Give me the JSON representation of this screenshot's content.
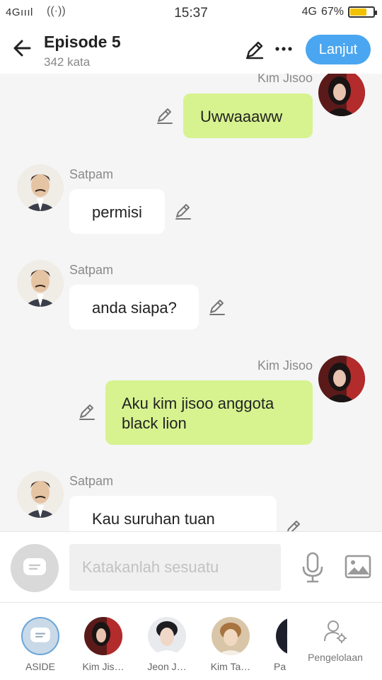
{
  "status": {
    "network": "4Gıııl",
    "time": "15:37",
    "network_right": "4G",
    "battery": "67%",
    "battery_level": 0.67
  },
  "header": {
    "title": "Episode 5",
    "subtitle": "342 kata",
    "next_label": "Lanjut"
  },
  "messages": [
    {
      "side": "right",
      "sender": "Kim Jisoo",
      "lines": [
        "Uwwaaaww"
      ]
    },
    {
      "side": "left",
      "sender": "Satpam",
      "lines": [
        "permisi"
      ]
    },
    {
      "side": "left",
      "sender": "Satpam",
      "lines": [
        "anda siapa?"
      ]
    },
    {
      "side": "right",
      "sender": "Kim Jisoo",
      "lines": [
        "Aku kim jisoo anggota",
        "black lion"
      ]
    },
    {
      "side": "left",
      "sender": "Satpam",
      "lines": [
        "Kau suruhan tuan"
      ]
    }
  ],
  "input": {
    "placeholder": "Katakanlah sesuatu"
  },
  "characters": [
    {
      "name": "ASIDE"
    },
    {
      "name": "Kim Jis…"
    },
    {
      "name": "Jeon J…"
    },
    {
      "name": "Kim Ta…"
    },
    {
      "name": "Pa"
    }
  ],
  "manage_label": "Pengelolaan",
  "colors": {
    "accent": "#4aa6f0",
    "bubble_self": "#d7f38f",
    "bubble_other": "#ffffff"
  }
}
